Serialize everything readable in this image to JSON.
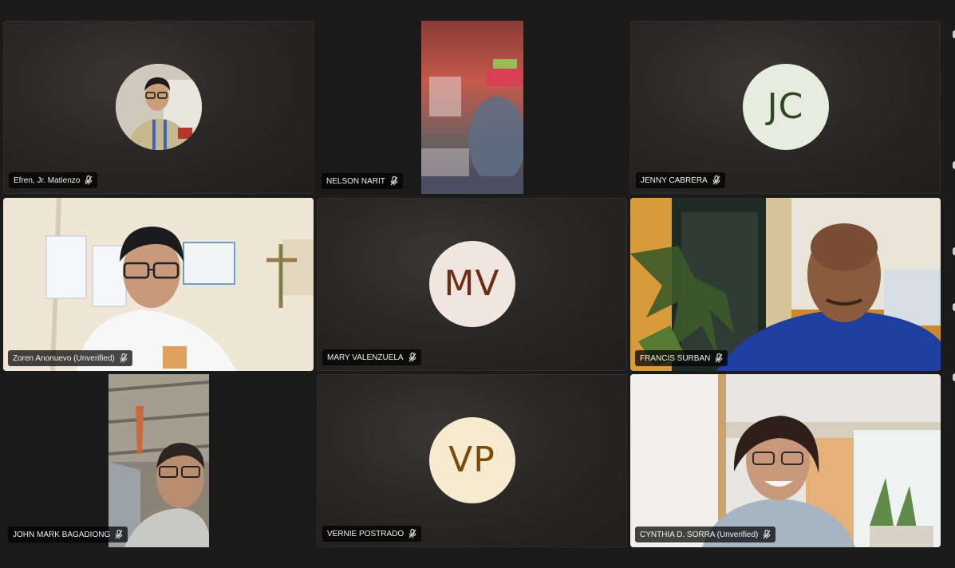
{
  "participants": [
    {
      "name": "Efren, Jr. Matienzo",
      "type": "photo"
    },
    {
      "name": "NELSON NARIT",
      "type": "video"
    },
    {
      "name": "JENNY CABRERA",
      "type": "initials",
      "initials": "JC",
      "circle_color": "#e8ecdf",
      "text_color": "#2f4a22"
    },
    {
      "name": "Zoren Anonuevo (Unverified)",
      "type": "video"
    },
    {
      "name": "MARY VALENZUELA",
      "type": "initials",
      "initials": "MV",
      "circle_color": "#f1e5df",
      "text_color": "#6b2d13"
    },
    {
      "name": "FRANCIS SURBAN",
      "type": "video"
    },
    {
      "name": "JOHN MARK BAGADIONG",
      "type": "video"
    },
    {
      "name": "VERNIE POSTRADO",
      "type": "initials",
      "initials": "VP",
      "circle_color": "#f6ead0",
      "text_color": "#7a4a06"
    },
    {
      "name": "CYNTHIA D. SORRA (Unverified)",
      "type": "video"
    }
  ],
  "icons": {
    "mic_muted": "mic-muted-icon"
  }
}
